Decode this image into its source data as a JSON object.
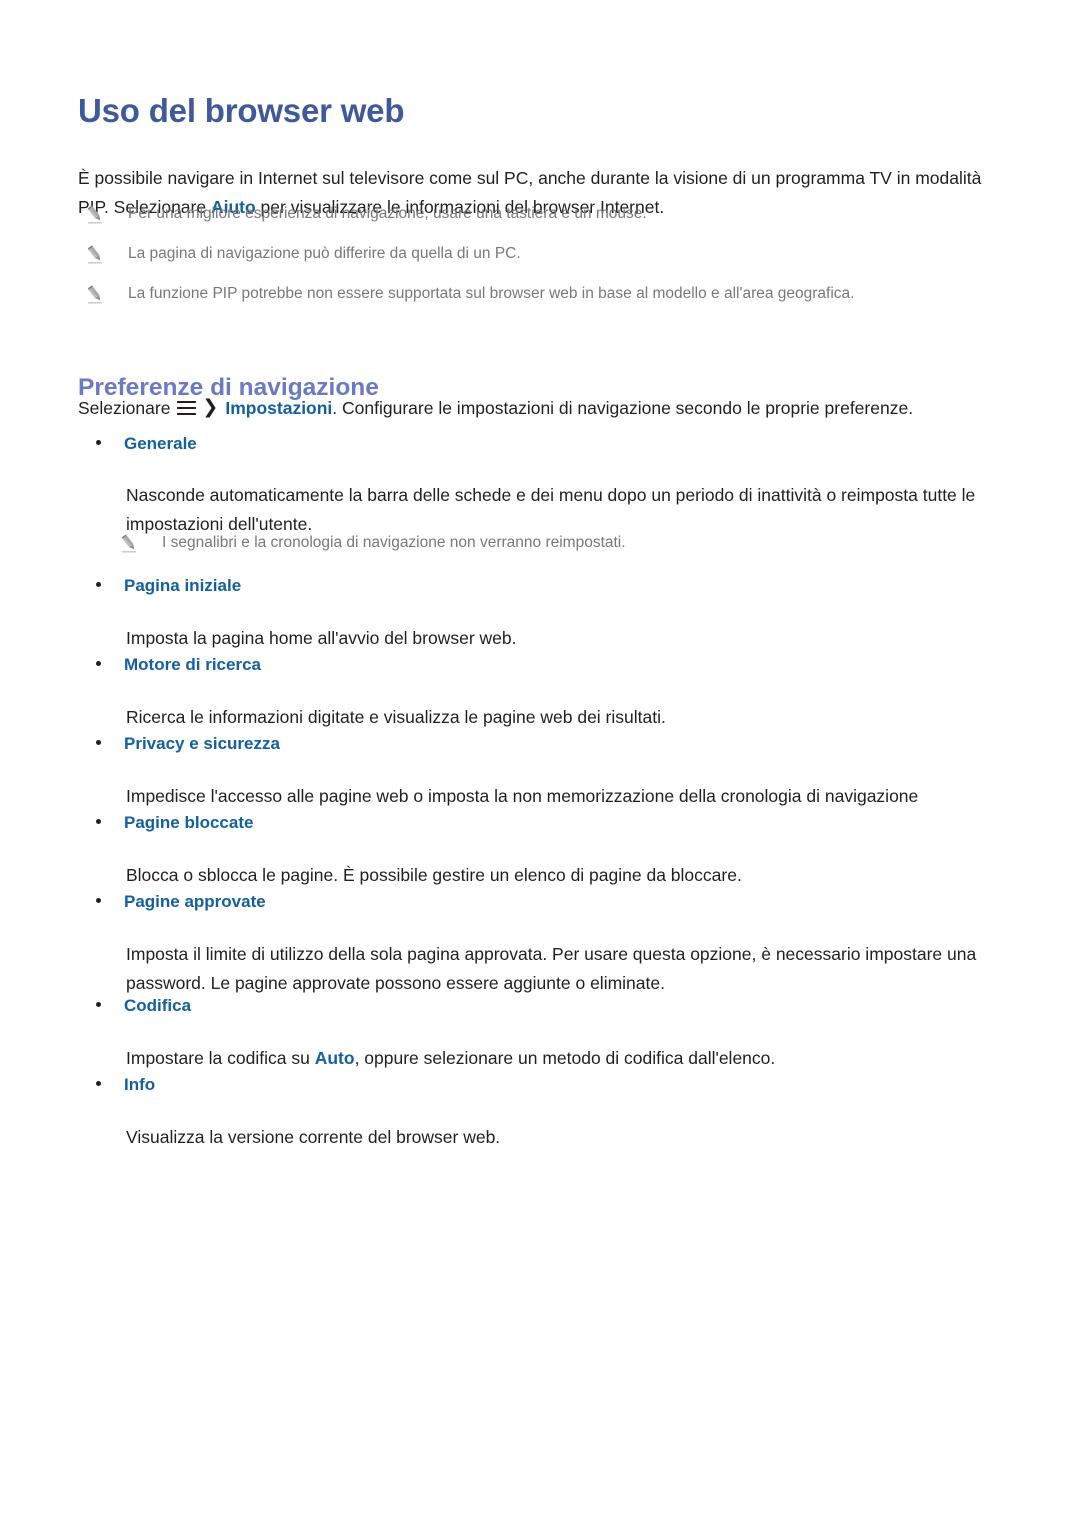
{
  "document": {
    "title": "Uso del browser web",
    "intro": {
      "text_before": "È possibile navigare in Internet sul televisore come sul PC, anche durante la visione di un programma TV in modalità PIP. Selezionare ",
      "highlight": "Aiuto",
      "text_after": " per visualizzare le informazioni del browser Internet."
    },
    "top_notes": [
      {
        "icon": "pencil-icon",
        "text": "Per una migliore esperienza di navigazione, usare una tastiera e un mouse."
      },
      {
        "icon": "pencil-icon",
        "text": "La pagina di navigazione può differire da quella di un PC."
      },
      {
        "icon": "pencil-icon",
        "text": "La funzione PIP potrebbe non essere supportata sul browser web in base al modello e all'area geografica."
      }
    ],
    "section": {
      "heading": "Preferenze di navigazione",
      "select_line": {
        "prefix": "Selezionare",
        "menu_icon": "hamburger-menu-icon",
        "chevron": "›",
        "menu_target": "Impostazioni",
        "suffix": ". Configurare le impostazioni di navigazione secondo le proprie preferenze."
      },
      "items": [
        {
          "label": "Generale",
          "description": "Nasconde automaticamente la barra delle schede e dei menu dopo un periodo di inattività o reimposta tutte le impostazioni dell'utente.",
          "note": {
            "icon": "pencil-icon",
            "text": "I segnalibri e la cronologia di navigazione non verranno reimpostati."
          }
        },
        {
          "label": "Pagina iniziale",
          "description": "Imposta la pagina home all'avvio del browser web."
        },
        {
          "label": "Motore di ricerca",
          "description": "Ricerca le informazioni digitate e visualizza le pagine web dei risultati."
        },
        {
          "label": "Privacy e sicurezza",
          "description": "Impedisce l'accesso alle pagine web o imposta la non memorizzazione della cronologia di navigazione"
        },
        {
          "label": "Pagine bloccate",
          "description": "Blocca o sblocca le pagine. È possibile gestire un elenco di pagine da bloccare."
        },
        {
          "label": "Pagine approvate",
          "description": "Imposta il limite di utilizzo della sola pagina approvata. Per usare questa opzione, è necessario impostare una password. Le pagine approvate possono essere aggiunte o eliminate."
        },
        {
          "label": "Codifica",
          "description_before": "Impostare la codifica su ",
          "description_highlight": "Auto",
          "description_after": ", oppure selezionare un metodo di codifica dall'elenco."
        },
        {
          "label": "Info",
          "description": "Visualizza la versione corrente del browser web."
        }
      ]
    },
    "colors": {
      "title_blue": "#3f5999",
      "heading_blue": "#6b7ac4",
      "link_blue": "#14609e",
      "body_text": "#231f20",
      "note_gray": "#77787b",
      "background": "#ffffff"
    }
  }
}
